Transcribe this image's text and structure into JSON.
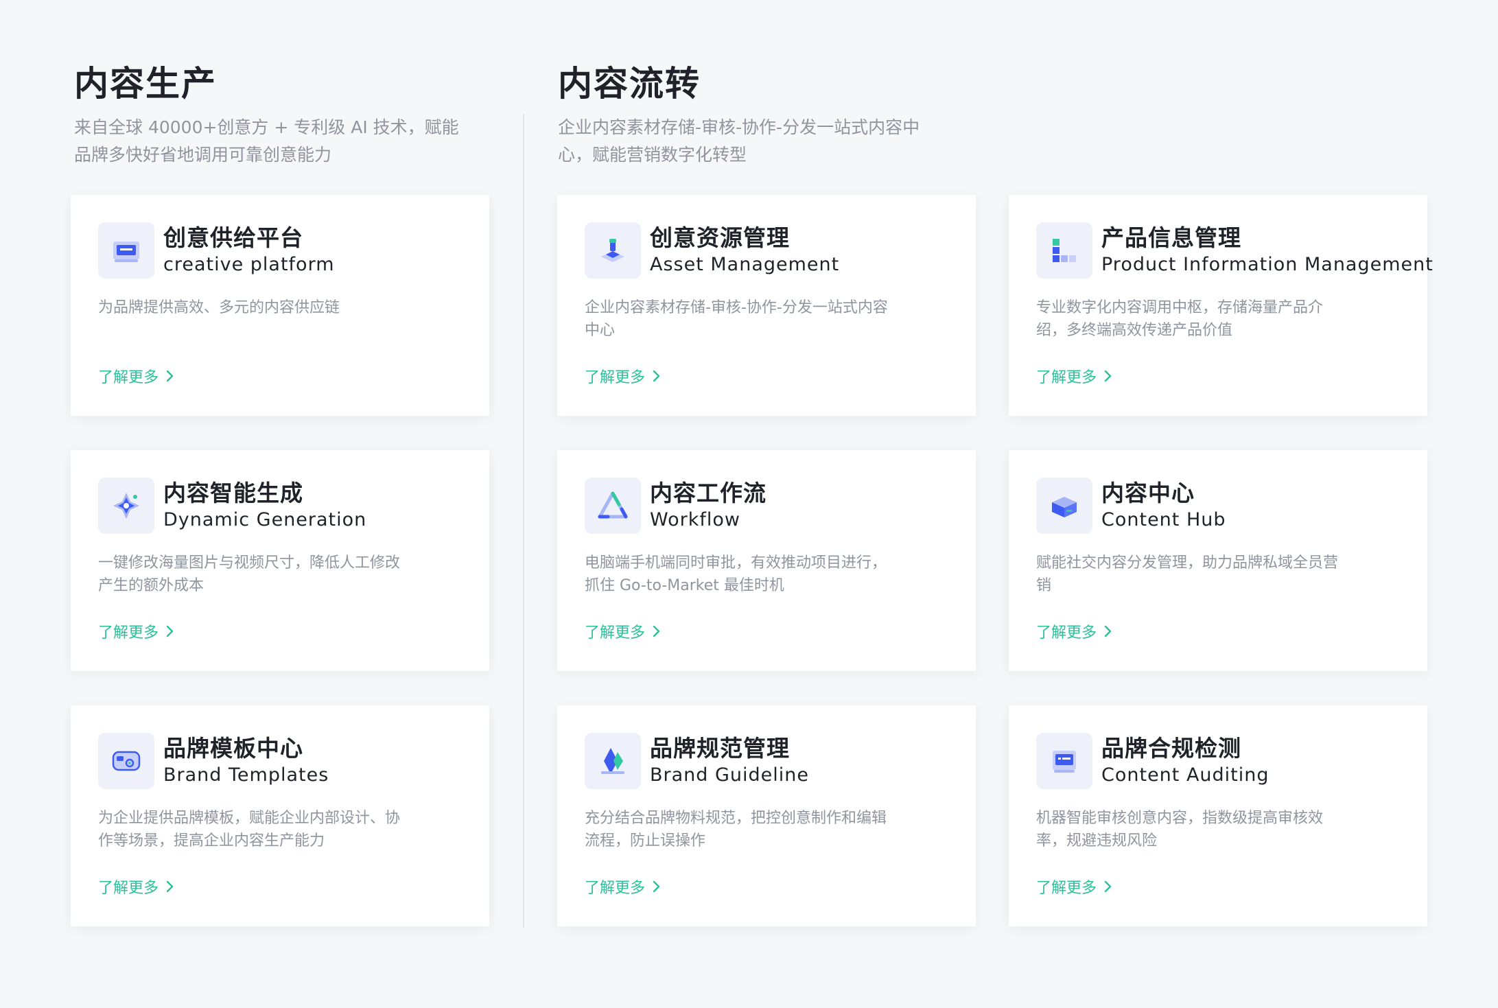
{
  "sections": [
    {
      "title": "内容生产",
      "description_lines": [
        "来自全球 40000+创意方 + 专利级 AI 技术，赋能",
        "品牌多快好省地调用可靠创意能力"
      ]
    },
    {
      "title": "内容流转",
      "description_lines": [
        "企业内容素材存储-审核-协作-分发一站式内容中",
        "心，赋能营销数字化转型"
      ]
    }
  ],
  "cards": [
    {
      "title": "创意供给平台",
      "subtitle": "creative platform",
      "description_lines": [
        "为品牌提供高效、多元的内容供应链"
      ],
      "link": "了解更多",
      "icon": "creative-platform-icon"
    },
    {
      "title": "创意资源管理",
      "subtitle": "Asset Management",
      "description_lines": [
        "企业内容素材存储-审核-协作-分发一站式内容",
        "中心"
      ],
      "link": "了解更多",
      "icon": "asset-management-icon"
    },
    {
      "title": "产品信息管理",
      "subtitle": "Product Information Management",
      "description_lines": [
        "专业数字化内容调用中枢，存储海量产品介",
        "绍，多终端高效传递产品价值"
      ],
      "link": "了解更多",
      "icon": "product-information-icon"
    },
    {
      "title": "内容智能生成",
      "subtitle": "Dynamic Generation",
      "description_lines": [
        "一键修改海量图片与视频尺寸，降低人工修改",
        "产生的额外成本"
      ],
      "link": "了解更多",
      "icon": "dynamic-generation-icon"
    },
    {
      "title": "内容工作流",
      "subtitle": "Workflow",
      "description_lines": [
        "电脑端手机端同时审批，有效推动项目进行，",
        "抓住 Go-to-Market 最佳时机"
      ],
      "link": "了解更多",
      "icon": "workflow-icon"
    },
    {
      "title": "内容中心",
      "subtitle": "Content Hub",
      "description_lines": [
        "赋能社交内容分发管理，助力品牌私域全员营",
        "销"
      ],
      "link": "了解更多",
      "icon": "content-hub-icon"
    },
    {
      "title": "品牌模板中心",
      "subtitle": "Brand Templates",
      "description_lines": [
        "为企业提供品牌模板，赋能企业内部设计、协",
        "作等场景，提高企业内容生产能力"
      ],
      "link": "了解更多",
      "icon": "brand-templates-icon"
    },
    {
      "title": "品牌规范管理",
      "subtitle": "Brand Guideline",
      "description_lines": [
        "充分结合品牌物料规范，把控创意制作和编辑",
        "流程，防止误操作"
      ],
      "link": "了解更多",
      "icon": "brand-guideline-icon"
    },
    {
      "title": "品牌合规检测",
      "subtitle": "Content Auditing",
      "description_lines": [
        "机器智能审核创意内容，指数级提高审核效",
        "率，规避违规风险"
      ],
      "link": "了解更多",
      "icon": "content-auditing-icon"
    }
  ],
  "colors": {
    "background": "#f6f7f9",
    "card": "#ffffff",
    "title": "#1f2329",
    "description": "#8f959e",
    "link": "#2bbf9a",
    "icon_blue": "#3d5af1",
    "icon_green": "#34c9a0"
  }
}
